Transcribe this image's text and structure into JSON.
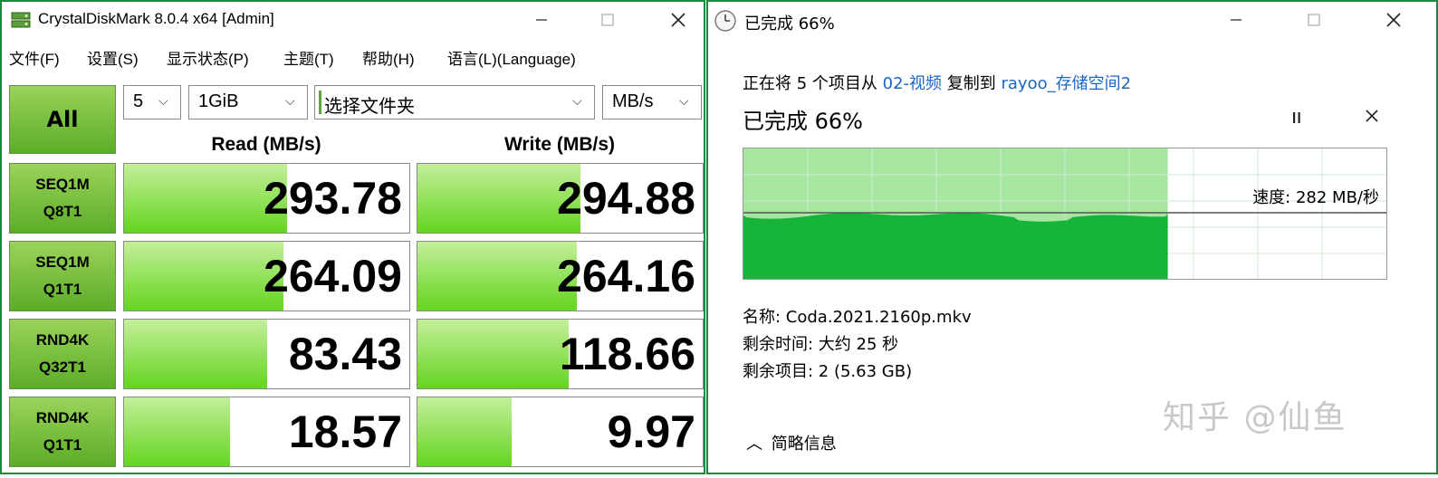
{
  "cdm": {
    "title": "CrystalDiskMark 8.0.4 x64 [Admin]",
    "menu": [
      "文件(F)",
      "设置(S)",
      "显示状态(P)",
      "主题(T)",
      "帮助(H)",
      "语言(L)(Language)"
    ],
    "all_label": "All",
    "count_select": "5",
    "size_select": "1GiB",
    "folder_select": "选择文件夹",
    "unit_select": "MB/s",
    "read_header": "Read (MB/s)",
    "write_header": "Write (MB/s)",
    "rows": [
      {
        "line1": "SEQ1M",
        "line2": "Q8T1",
        "read": "293.78",
        "write": "294.88",
        "read_pct": 0.57,
        "write_pct": 0.57
      },
      {
        "line1": "SEQ1M",
        "line2": "Q1T1",
        "read": "264.09",
        "write": "264.16",
        "read_pct": 0.56,
        "write_pct": 0.56
      },
      {
        "line1": "RND4K",
        "line2": "Q32T1",
        "read": "83.43",
        "write": "118.66",
        "read_pct": 0.5,
        "write_pct": 0.53
      },
      {
        "line1": "RND4K",
        "line2": "Q1T1",
        "read": "18.57",
        "write": "9.97",
        "read_pct": 0.37,
        "write_pct": 0.33
      }
    ],
    "colors": {
      "accent": "#5cad26",
      "bar_light": "#c4ef9a"
    }
  },
  "copy": {
    "title": "已完成 66%",
    "line_prefix": "正在将 5 个项目从 ",
    "source": "02-视频",
    "line_mid": " 复制到 ",
    "dest": "rayoo_存储空间2",
    "status": "已完成 66%",
    "progress_fraction": 0.66,
    "speed": "速度: 282 MB/秒",
    "name": "名称: Coda.2021.2160p.mkv",
    "time_left": "剩余时间: 大约 25 秒",
    "items_left": "剩余项目: 2 (5.63 GB)",
    "more_label": "简略信息",
    "colors": {
      "fill_done": "#a6e6a0",
      "fill_area": "#16b53a",
      "link": "#1a66c8"
    }
  },
  "watermark": "知乎 @仙鱼"
}
